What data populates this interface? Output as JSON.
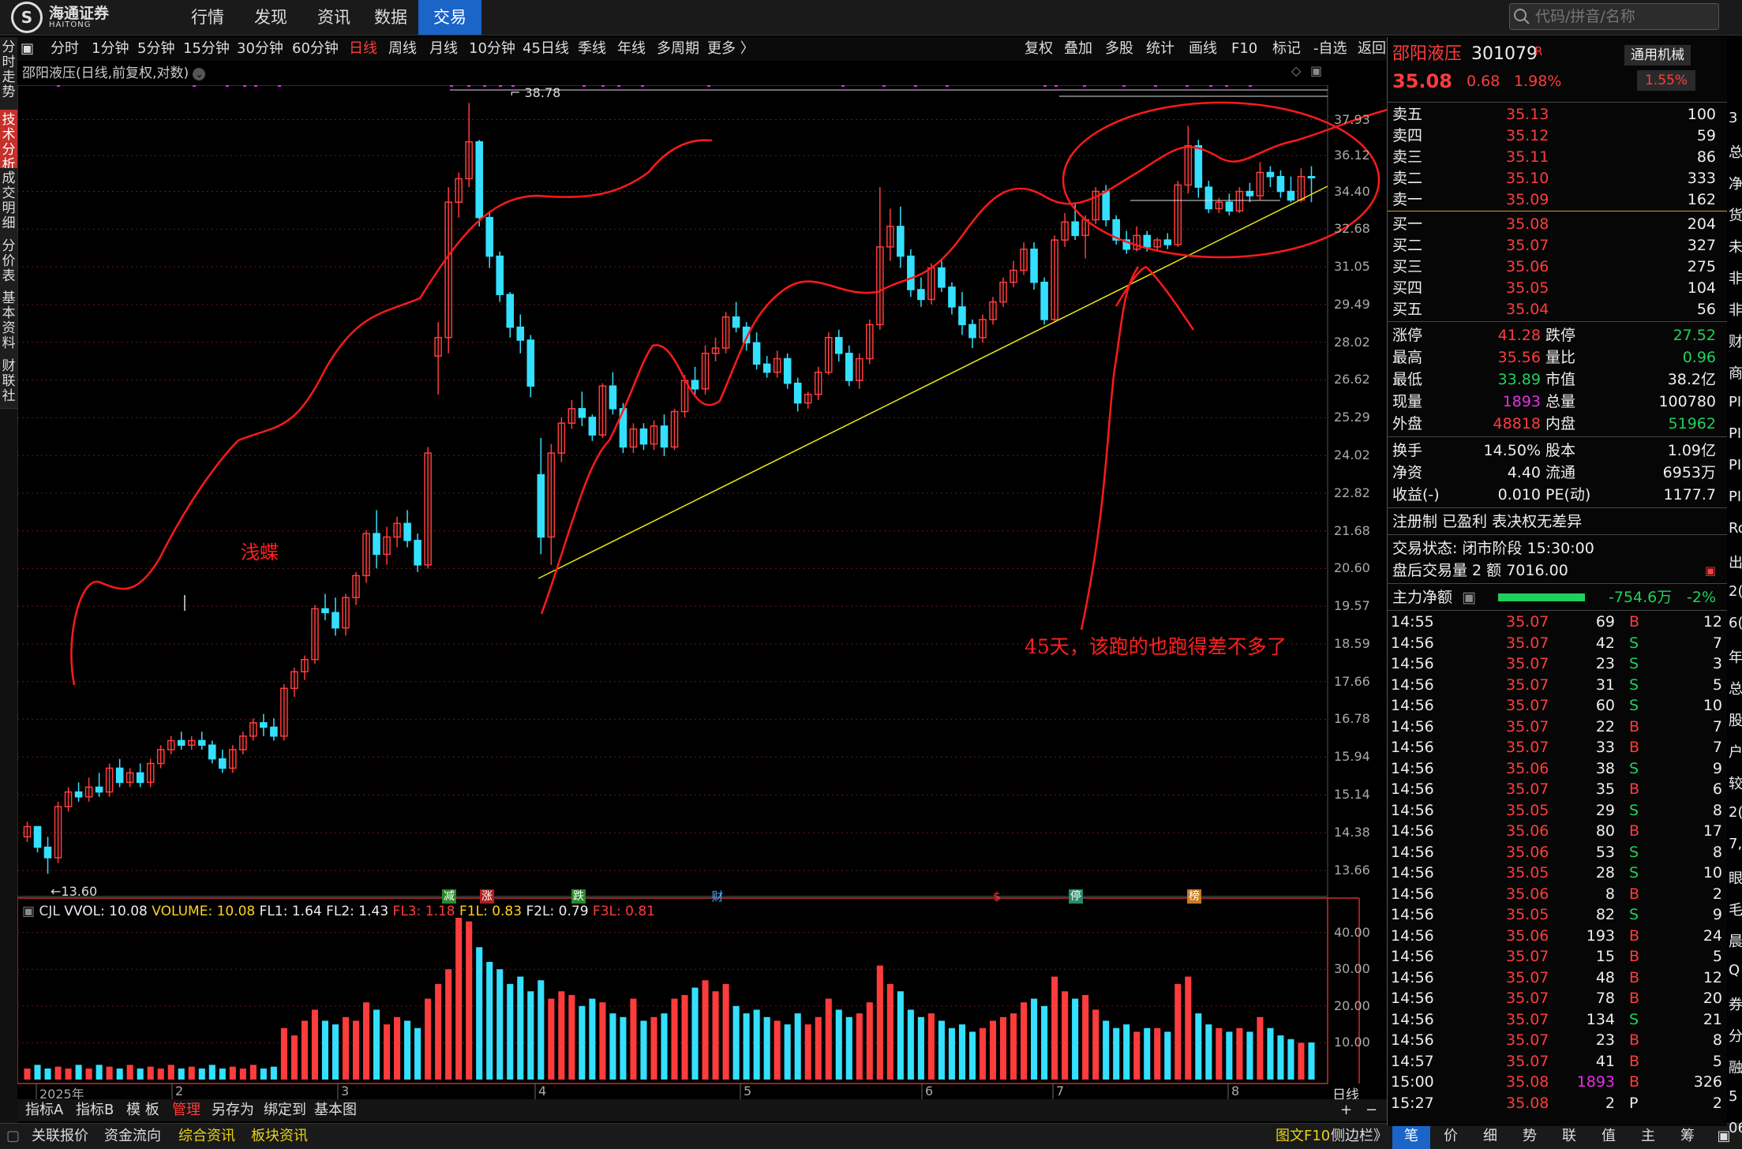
{
  "topbar": {
    "logo_text": "海通证券",
    "logo_sub": "HAITONG",
    "nav": [
      "行情",
      "发现",
      "资讯",
      "数据",
      "交易"
    ],
    "active_nav": "交易",
    "search_placeholder": "代码/拼音/名称"
  },
  "left_tabs": [
    "分时走势",
    "技术分析",
    "成交明细",
    "分价表",
    "基本资料",
    "财联社"
  ],
  "active_left_tab": "技术分析",
  "period_bar": {
    "items": [
      "分时",
      "1分钟",
      "5分钟",
      "15分钟",
      "30分钟",
      "60分钟",
      "日线",
      "周线",
      "月线",
      "10分钟",
      "45日线",
      "季线",
      "年线",
      "多周期",
      "更多 〉"
    ],
    "selected": "日线",
    "tools": [
      "复权",
      "叠加",
      "多股",
      "统计",
      "画线",
      "F10",
      "标记",
      "-自选",
      "返回"
    ]
  },
  "chart_title": "邵阳液压(日线,前复权,对数)",
  "annotations": {
    "left_text": "浅蝶",
    "right_text": "45天，该跑的也跑得差不多了",
    "high_label": "38.78",
    "low_label": "←13.60"
  },
  "event_markers": [
    "减",
    "涨",
    "跌",
    "财",
    "$",
    "停",
    "榜"
  ],
  "x_axis_labels": [
    "2025年",
    "2",
    "3",
    "4",
    "5",
    "6",
    "7",
    "8"
  ],
  "period_label": "日线",
  "vol_info": {
    "name": "CJL",
    "items": [
      {
        "label": "VVOL: 10.08",
        "color": "#eeeeee"
      },
      {
        "label": "VOLUME: 10.08",
        "color": "#ffd21e"
      },
      {
        "label": "FL1: 1.64",
        "color": "#eeeeee"
      },
      {
        "label": "FL2: 1.43",
        "color": "#eeeeee"
      },
      {
        "label": "FL3: 1.18",
        "color": "#ff3c3c"
      },
      {
        "label": "F1L: 0.83",
        "color": "#ffd21e"
      },
      {
        "label": "F2L: 0.79",
        "color": "#eeeeee"
      },
      {
        "label": "F3L: 0.81",
        "color": "#ff3c3c"
      }
    ]
  },
  "chart_data": {
    "type": "candlestick",
    "price_scale": "log",
    "price_ticks": [
      37.93,
      36.12,
      34.4,
      32.68,
      31.05,
      29.49,
      28.02,
      26.62,
      25.29,
      24.02,
      22.82,
      21.68,
      20.6,
      19.57,
      18.59,
      17.66,
      16.78,
      15.94,
      15.14,
      14.38,
      13.66
    ],
    "volume_ticks": [
      "40.00",
      "30.00",
      "20.00",
      "10.00"
    ],
    "ylim": [
      13.3,
      38.9
    ],
    "vol_max": 44,
    "high": 38.78,
    "low": 13.6,
    "candles": [
      [
        14.3,
        14.6,
        14.5,
        14.2
      ],
      [
        14.5,
        14.5,
        14.1,
        14.0
      ],
      [
        14.1,
        14.3,
        13.9,
        13.6
      ],
      [
        13.9,
        15.0,
        14.9,
        13.8
      ],
      [
        14.9,
        15.3,
        15.2,
        14.8
      ],
      [
        15.2,
        15.4,
        15.1,
        15.0
      ],
      [
        15.1,
        15.5,
        15.3,
        15.0
      ],
      [
        15.3,
        15.6,
        15.2,
        15.1
      ],
      [
        15.2,
        15.8,
        15.7,
        15.1
      ],
      [
        15.7,
        15.9,
        15.4,
        15.3
      ],
      [
        15.4,
        15.7,
        15.6,
        15.3
      ],
      [
        15.6,
        15.8,
        15.4,
        15.3
      ],
      [
        15.4,
        15.9,
        15.8,
        15.3
      ],
      [
        15.8,
        16.2,
        16.1,
        15.7
      ],
      [
        16.1,
        16.4,
        16.3,
        16.0
      ],
      [
        16.3,
        16.5,
        16.2,
        16.1
      ],
      [
        16.2,
        16.4,
        16.3,
        16.1
      ],
      [
        16.3,
        16.5,
        16.2,
        16.1
      ],
      [
        16.2,
        16.3,
        15.9,
        15.8
      ],
      [
        15.9,
        16.1,
        15.7,
        15.6
      ],
      [
        15.7,
        16.2,
        16.1,
        15.6
      ],
      [
        16.1,
        16.5,
        16.4,
        16.0
      ],
      [
        16.4,
        16.8,
        16.7,
        16.3
      ],
      [
        16.7,
        16.9,
        16.6,
        16.4
      ],
      [
        16.6,
        16.8,
        16.4,
        16.3
      ],
      [
        16.4,
        17.6,
        17.5,
        16.3
      ],
      [
        17.5,
        18.0,
        17.9,
        17.3
      ],
      [
        17.9,
        18.3,
        18.2,
        17.7
      ],
      [
        18.2,
        19.6,
        19.5,
        18.1
      ],
      [
        19.5,
        19.9,
        19.4,
        19.2
      ],
      [
        19.4,
        19.8,
        19.0,
        18.8
      ],
      [
        19.0,
        19.9,
        19.8,
        18.8
      ],
      [
        19.8,
        20.5,
        20.4,
        19.6
      ],
      [
        20.4,
        21.7,
        21.6,
        20.2
      ],
      [
        21.6,
        22.3,
        21.0,
        20.6
      ],
      [
        21.0,
        21.8,
        21.5,
        20.7
      ],
      [
        21.5,
        22.1,
        21.9,
        21.2
      ],
      [
        21.9,
        22.3,
        21.4,
        21.2
      ],
      [
        21.4,
        21.6,
        20.7,
        20.5
      ],
      [
        20.7,
        24.3,
        24.1,
        20.6
      ],
      [
        27.5,
        28.8,
        28.2,
        26.1
      ],
      [
        28.2,
        34.6,
        33.9,
        27.6
      ],
      [
        33.9,
        35.3,
        35.0,
        33.2
      ],
      [
        35.0,
        38.8,
        36.8,
        34.6
      ],
      [
        36.8,
        36.9,
        33.2,
        32.8
      ],
      [
        33.2,
        33.5,
        31.5,
        31.0
      ],
      [
        31.5,
        31.7,
        29.9,
        29.6
      ],
      [
        29.9,
        30.0,
        28.6,
        28.2
      ],
      [
        28.6,
        29.1,
        28.1,
        27.6
      ],
      [
        28.1,
        28.3,
        26.4,
        26.0
      ],
      [
        23.4,
        24.6,
        21.5,
        21.0
      ],
      [
        21.5,
        24.4,
        24.1,
        20.7
      ],
      [
        24.1,
        25.3,
        25.1,
        23.8
      ],
      [
        25.1,
        25.9,
        25.6,
        24.9
      ],
      [
        25.6,
        26.2,
        25.3,
        25.0
      ],
      [
        25.3,
        25.4,
        24.7,
        24.5
      ],
      [
        24.7,
        26.5,
        26.4,
        24.6
      ],
      [
        26.4,
        26.9,
        25.6,
        25.4
      ],
      [
        25.6,
        25.8,
        24.3,
        24.1
      ],
      [
        24.3,
        25.1,
        24.9,
        24.1
      ],
      [
        24.9,
        25.1,
        24.4,
        24.2
      ],
      [
        24.4,
        25.2,
        25.0,
        24.2
      ],
      [
        25.0,
        25.4,
        24.3,
        24.0
      ],
      [
        24.3,
        25.6,
        25.5,
        24.2
      ],
      [
        25.5,
        26.8,
        26.6,
        25.3
      ],
      [
        26.6,
        27.1,
        26.3,
        26.1
      ],
      [
        26.3,
        27.9,
        27.6,
        26.1
      ],
      [
        27.6,
        28.2,
        27.8,
        27.3
      ],
      [
        27.8,
        29.2,
        29.0,
        27.6
      ],
      [
        29.0,
        29.6,
        28.6,
        28.4
      ],
      [
        28.6,
        28.8,
        28.0,
        27.7
      ],
      [
        28.0,
        28.4,
        27.2,
        27.0
      ],
      [
        27.2,
        27.5,
        26.9,
        26.7
      ],
      [
        26.9,
        27.7,
        27.4,
        26.7
      ],
      [
        27.4,
        27.6,
        26.5,
        26.3
      ],
      [
        26.5,
        26.7,
        25.8,
        25.5
      ],
      [
        25.8,
        26.2,
        26.1,
        25.6
      ],
      [
        26.1,
        27.1,
        26.9,
        25.9
      ],
      [
        26.9,
        28.4,
        28.2,
        26.8
      ],
      [
        28.2,
        28.5,
        27.6,
        27.3
      ],
      [
        27.6,
        27.9,
        26.6,
        26.4
      ],
      [
        26.6,
        27.6,
        27.4,
        26.3
      ],
      [
        27.4,
        28.9,
        28.7,
        27.2
      ],
      [
        28.7,
        34.6,
        31.9,
        28.5
      ],
      [
        31.9,
        33.6,
        32.8,
        31.3
      ],
      [
        32.8,
        33.7,
        31.5,
        31.0
      ],
      [
        31.5,
        31.8,
        30.1,
        29.8
      ],
      [
        30.1,
        30.6,
        29.7,
        29.4
      ],
      [
        29.7,
        31.2,
        31.0,
        29.5
      ],
      [
        31.0,
        31.4,
        30.2,
        30.0
      ],
      [
        30.2,
        30.4,
        29.4,
        29.1
      ],
      [
        29.4,
        30.0,
        28.7,
        28.3
      ],
      [
        28.7,
        28.9,
        28.2,
        27.8
      ],
      [
        28.2,
        29.1,
        28.9,
        28.0
      ],
      [
        28.9,
        29.8,
        29.6,
        28.7
      ],
      [
        29.6,
        30.6,
        30.4,
        29.4
      ],
      [
        30.4,
        31.3,
        30.9,
        30.2
      ],
      [
        30.9,
        32.1,
        31.8,
        30.7
      ],
      [
        31.8,
        32.1,
        30.4,
        30.1
      ],
      [
        30.4,
        30.6,
        28.9,
        28.7
      ],
      [
        28.9,
        32.4,
        32.2,
        28.8
      ],
      [
        32.2,
        33.4,
        33.0,
        31.9
      ],
      [
        33.0,
        33.9,
        32.4,
        32.2
      ],
      [
        32.4,
        33.3,
        33.1,
        31.4
      ],
      [
        33.1,
        34.6,
        34.4,
        32.9
      ],
      [
        34.4,
        34.7,
        33.1,
        32.8
      ],
      [
        33.1,
        33.3,
        32.2,
        32.0
      ],
      [
        32.2,
        32.6,
        31.8,
        31.6
      ],
      [
        31.8,
        32.8,
        32.4,
        31.7
      ],
      [
        32.4,
        32.6,
        31.9,
        31.7
      ],
      [
        31.9,
        32.3,
        32.2,
        31.7
      ],
      [
        32.2,
        32.5,
        32.0,
        31.8
      ],
      [
        32.0,
        34.9,
        34.7,
        31.9
      ],
      [
        34.7,
        37.6,
        36.6,
        34.3
      ],
      [
        36.6,
        36.9,
        34.6,
        34.1
      ],
      [
        34.6,
        34.9,
        33.6,
        33.4
      ],
      [
        33.6,
        34.1,
        33.9,
        33.4
      ],
      [
        33.9,
        34.3,
        33.5,
        33.3
      ],
      [
        33.5,
        34.6,
        34.4,
        33.4
      ],
      [
        34.4,
        34.8,
        34.2,
        33.9
      ],
      [
        34.2,
        35.8,
        35.3,
        34.0
      ],
      [
        35.3,
        35.6,
        35.1,
        34.6
      ],
      [
        35.1,
        35.4,
        34.4,
        34.1
      ],
      [
        34.4,
        35.1,
        34.0,
        33.9
      ],
      [
        34.0,
        35.5,
        35.1,
        33.9
      ],
      [
        35.1,
        35.6,
        35.08,
        33.9
      ]
    ],
    "volumes": [
      3,
      4,
      3,
      3.5,
      3,
      4,
      3,
      4,
      3.5,
      3,
      4,
      3,
      3.5,
      3,
      4,
      3,
      3.5,
      3,
      4,
      3,
      3.5,
      3,
      4,
      3,
      3.5,
      14,
      12,
      16,
      19,
      16,
      15,
      17,
      16,
      21,
      19,
      15,
      17,
      16,
      14,
      22,
      26,
      30,
      44,
      43,
      36,
      32,
      30,
      26,
      28,
      24,
      27,
      22,
      24,
      23,
      20,
      22,
      21,
      18,
      17,
      22,
      16,
      17,
      18,
      22,
      23,
      25,
      27,
      24,
      26,
      20,
      18,
      19,
      17,
      16,
      15,
      18,
      15,
      17,
      22,
      19,
      17,
      18,
      21,
      31,
      26,
      24,
      19,
      17,
      18,
      16,
      14,
      15,
      13,
      14,
      16,
      17,
      18,
      21,
      22,
      20,
      28,
      24,
      22,
      23,
      19,
      16,
      14,
      15,
      13,
      14,
      14,
      13,
      26,
      28,
      18,
      15,
      14,
      13,
      14,
      13,
      17,
      14,
      12,
      11,
      10,
      10.08
    ]
  },
  "right_panel": {
    "stock_name": "邵阳液压",
    "stock_code": "301079",
    "r_badge": "R",
    "price": "35.08",
    "change": "0.68",
    "change_pct": "1.98%",
    "inst_label": "通用机械",
    "inst_pct": "1.55%",
    "asks": [
      {
        "label": "卖五",
        "price": "35.13",
        "vol": "100"
      },
      {
        "label": "卖四",
        "price": "35.12",
        "vol": "59"
      },
      {
        "label": "卖三",
        "price": "35.11",
        "vol": "86"
      },
      {
        "label": "卖二",
        "price": "35.10",
        "vol": "333"
      },
      {
        "label": "卖一",
        "price": "35.09",
        "vol": "162"
      }
    ],
    "bids": [
      {
        "label": "买一",
        "price": "35.08",
        "vol": "204"
      },
      {
        "label": "买二",
        "price": "35.07",
        "vol": "327"
      },
      {
        "label": "买三",
        "price": "35.06",
        "vol": "275"
      },
      {
        "label": "买四",
        "price": "35.05",
        "vol": "104"
      },
      {
        "label": "买五",
        "price": "35.04",
        "vol": "56"
      }
    ],
    "stats1": [
      {
        "l1": "涨停",
        "v1": "41.28",
        "c1": "red",
        "l2": "跌停",
        "v2": "27.52",
        "c2": "green"
      },
      {
        "l1": "最高",
        "v1": "35.56",
        "c1": "red",
        "l2": "量比",
        "v2": "0.96",
        "c2": "green"
      },
      {
        "l1": "最低",
        "v1": "33.89",
        "c1": "green",
        "l2": "市值",
        "v2": "38.2亿",
        "c2": "white"
      },
      {
        "l1": "现量",
        "v1": "1893",
        "c1": "magenta",
        "l2": "总量",
        "v2": "100780",
        "c2": "white"
      },
      {
        "l1": "外盘",
        "v1": "48818",
        "c1": "red",
        "l2": "内盘",
        "v2": "51962",
        "c2": "green"
      }
    ],
    "stats2": [
      {
        "l1": "换手",
        "v1": "14.50%",
        "c1": "white",
        "l2": "股本",
        "v2": "1.09亿",
        "c2": "white"
      },
      {
        "l1": "净资",
        "v1": "4.40",
        "c1": "white",
        "l2": "流通",
        "v2": "6953万",
        "c2": "white"
      },
      {
        "l1": "收益(-)",
        "v1": "0.010",
        "c1": "white",
        "l2": "PE(动)",
        "v2": "1177.7",
        "c2": "white"
      }
    ],
    "reg_info": "注册制 已盈利 表决权无差异",
    "trade_status": "交易状态: 闭市阶段 15:30:00",
    "after_hours": "盘后交易量 2 额 7016.00",
    "main_flow_label": "主力净额",
    "main_flow_value": "-754.6万",
    "main_flow_pct": "-2%",
    "ticks": [
      [
        "14:55",
        "35.07",
        "69",
        "B",
        "12"
      ],
      [
        "14:56",
        "35.07",
        "42",
        "S",
        "7"
      ],
      [
        "14:56",
        "35.07",
        "23",
        "S",
        "3"
      ],
      [
        "14:56",
        "35.07",
        "31",
        "S",
        "5"
      ],
      [
        "14:56",
        "35.07",
        "60",
        "S",
        "10"
      ],
      [
        "14:56",
        "35.07",
        "22",
        "B",
        "7"
      ],
      [
        "14:56",
        "35.07",
        "33",
        "B",
        "7"
      ],
      [
        "14:56",
        "35.06",
        "38",
        "S",
        "9"
      ],
      [
        "14:56",
        "35.07",
        "35",
        "B",
        "6"
      ],
      [
        "14:56",
        "35.05",
        "29",
        "S",
        "8"
      ],
      [
        "14:56",
        "35.06",
        "80",
        "B",
        "17"
      ],
      [
        "14:56",
        "35.06",
        "53",
        "S",
        "8"
      ],
      [
        "14:56",
        "35.05",
        "28",
        "S",
        "10"
      ],
      [
        "14:56",
        "35.06",
        "8",
        "B",
        "2"
      ],
      [
        "14:56",
        "35.05",
        "82",
        "S",
        "9"
      ],
      [
        "14:56",
        "35.06",
        "193",
        "B",
        "24"
      ],
      [
        "14:56",
        "35.07",
        "15",
        "B",
        "5"
      ],
      [
        "14:56",
        "35.07",
        "48",
        "B",
        "12"
      ],
      [
        "14:56",
        "35.07",
        "78",
        "B",
        "20"
      ],
      [
        "14:56",
        "35.07",
        "134",
        "S",
        "21"
      ],
      [
        "14:56",
        "35.07",
        "23",
        "B",
        "8"
      ],
      [
        "14:57",
        "35.07",
        "41",
        "B",
        "5"
      ],
      [
        "15:00",
        "35.08",
        "1893",
        "B",
        "326"
      ],
      [
        "15:27",
        "35.08",
        "2",
        "P",
        "2"
      ]
    ],
    "side_chars": [
      "3",
      "总",
      "净",
      "货",
      "未",
      "非",
      "非",
      "财",
      "商",
      "PI",
      "PI",
      "PI",
      "PI",
      "Ro",
      "出",
      "2(",
      "6(",
      "年",
      "总",
      "股",
      "户",
      "较",
      "2(",
      "7,",
      "眼",
      "毛",
      "晨",
      "Q",
      "券",
      "分",
      "融",
      "5",
      "06"
    ]
  },
  "bottom_bar1": [
    "指标A",
    "指标B",
    "模 板",
    "管理",
    "另存为",
    "绑定到",
    "基本图"
  ],
  "bottom_bar1_active": "管理",
  "bottom_bar2": [
    "关联报价",
    "资金流向",
    "综合资讯",
    "板块资讯"
  ],
  "bottom_bar2_right": [
    "图文F10",
    "侧边栏》"
  ],
  "bottom_tabs": [
    "笔",
    "价",
    "细",
    "势",
    "联",
    "值",
    "主",
    "筹"
  ],
  "bottom_tabs_active": "笔"
}
